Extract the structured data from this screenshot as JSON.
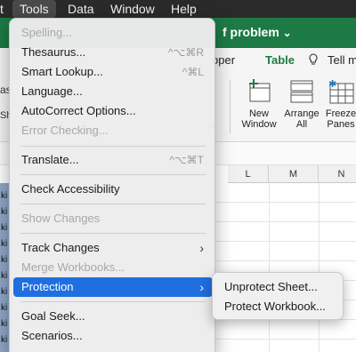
{
  "menubar": {
    "items": [
      "t",
      "Tools",
      "Data",
      "Window",
      "Help"
    ],
    "active": "Tools"
  },
  "window": {
    "doc_title": "f problem",
    "title_chevron": "⌄"
  },
  "ribbon_tabs": {
    "partial_left": "oper",
    "table": "Table",
    "tell_me": "Tell m"
  },
  "ribbon_buttons": {
    "new_window": "New\nWindow",
    "arrange_all": "Arrange\nAll",
    "freeze_panes": "Freeze\nPanes"
  },
  "columns": [
    "L",
    "M",
    "N"
  ],
  "left_fragments": {
    "as": "as",
    "sh": "Sh",
    "rows": [
      "ki",
      "ki",
      "ki",
      "ki",
      "ki",
      "ki",
      "ki",
      "ki",
      "ki",
      "ki"
    ]
  },
  "tools_menu": {
    "spelling": "Spelling...",
    "thesaurus": "Thesaurus...",
    "thesaurus_sc": "^⌥⌘R",
    "smart_lookup": "Smart Lookup...",
    "smart_lookup_sc": "^⌘L",
    "language": "Language...",
    "autocorrect": "AutoCorrect Options...",
    "error_checking": "Error Checking...",
    "translate": "Translate...",
    "translate_sc": "^⌥⌘T",
    "check_accessibility": "Check Accessibility",
    "show_changes": "Show Changes",
    "track_changes": "Track Changes",
    "merge_workbooks": "Merge Workbooks...",
    "protection": "Protection",
    "goal_seek": "Goal Seek...",
    "scenarios": "Scenarios...",
    "chevron": "›"
  },
  "protection_submenu": {
    "unprotect_sheet": "Unprotect Sheet...",
    "protect_workbook": "Protect Workbook..."
  },
  "colors": {
    "accent": "#1f6fe0",
    "excel_green": "#1d7a44"
  }
}
